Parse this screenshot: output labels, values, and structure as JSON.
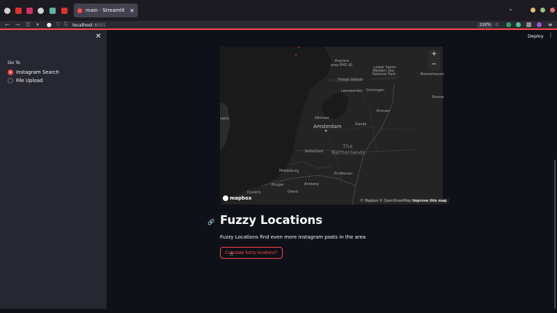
{
  "browser": {
    "tab_title": "main · Streamlit",
    "url_host": "localhost",
    "url_port": ":8501",
    "zoom": "110%"
  },
  "sidebar": {
    "section_label": "Go To",
    "options": [
      {
        "label": "Instagram Search",
        "selected": true
      },
      {
        "label": "File Upload",
        "selected": false
      }
    ]
  },
  "header": {
    "deploy_label": "Deploy",
    "menu_glyph": "⋮"
  },
  "map": {
    "labels": {
      "practice_area": "Practice",
      "practice_area2": "area EHD 42",
      "lower_saxon": "Lower Saxon",
      "wadden": "Wadden Sea",
      "national_park": "National Park",
      "frisian": "Frisian Islands",
      "bremerhaven": "Bremerhaven",
      "leeuwarden": "Leeuwarden",
      "groningen": "Groningen",
      "brema": "Breme",
      "emmen": "Emmen",
      "norwich": "rwich",
      "alkmaar": "Alkmaar",
      "amsterdam": "Amsterdam",
      "zwolle": "Zwolle",
      "the": "The",
      "netherlands": "Netherlands",
      "rotterdam": "Rotterdam",
      "middelburg": "Middelburg",
      "eindhoven": "Eindhoven",
      "brugges": "Bruges",
      "antwerp": "Antwerp",
      "dunkirk": "Dunkirk",
      "ghent": "Ghent"
    },
    "zoom_in": "+",
    "zoom_out": "−",
    "logo_text": "mapbox",
    "attribution_mapbox": "© Mapbox",
    "attribution_osm": "© OpenStreetMap",
    "attribution_improve": "Improve this map"
  },
  "main": {
    "title": "Fuzzy Locations",
    "description": "Fuzzy Locations find even more instagram posts in the area",
    "button_label": "Calculate fuzzy locations?"
  },
  "colors": {
    "accent": "#ff4b4b",
    "sidebar_bg": "#262730",
    "main_bg": "#0e1117"
  }
}
